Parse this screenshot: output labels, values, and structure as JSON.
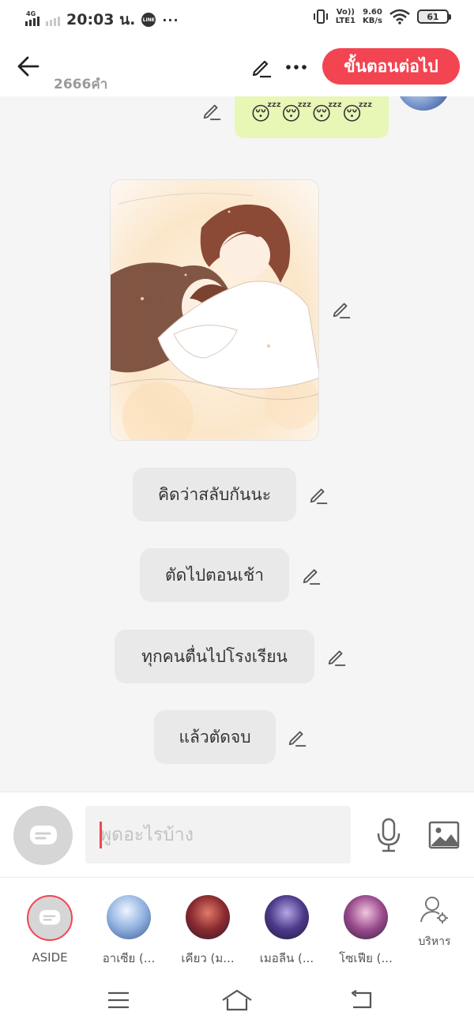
{
  "status_bar": {
    "network": "4G",
    "time": "20:03 น.",
    "notification_app": "LINE",
    "notification_more": "···",
    "volte": "Vo))",
    "lte": "LTE1",
    "speed_value": "9.60",
    "speed_unit": "KB/s",
    "battery": "61"
  },
  "header": {
    "word_count": "2666คำ",
    "next_label": "ขั้นตอนต่อไป",
    "next_color": "#f34452"
  },
  "chat": {
    "emoji_message": "😴😴😴😴",
    "image_description_icon": "sleeping-couple-illustration",
    "messages": [
      {
        "text": "คิดว่าสลับกันนะ"
      },
      {
        "text": "ตัดไปตอนเช้า"
      },
      {
        "text": "ทุกคนตื่นไปโรงเรียน"
      },
      {
        "text": "แล้วตัดจบ"
      }
    ]
  },
  "input_bar": {
    "placeholder": "พูดอะไรบ้าง"
  },
  "characters": [
    {
      "name": "ASIDE"
    },
    {
      "name": "อาเซีย (..."
    },
    {
      "name": "เคียว (ม..."
    },
    {
      "name": "เมอลีน (..."
    },
    {
      "name": "โซเฟีย (..."
    }
  ],
  "manage_label": "บริหาร"
}
